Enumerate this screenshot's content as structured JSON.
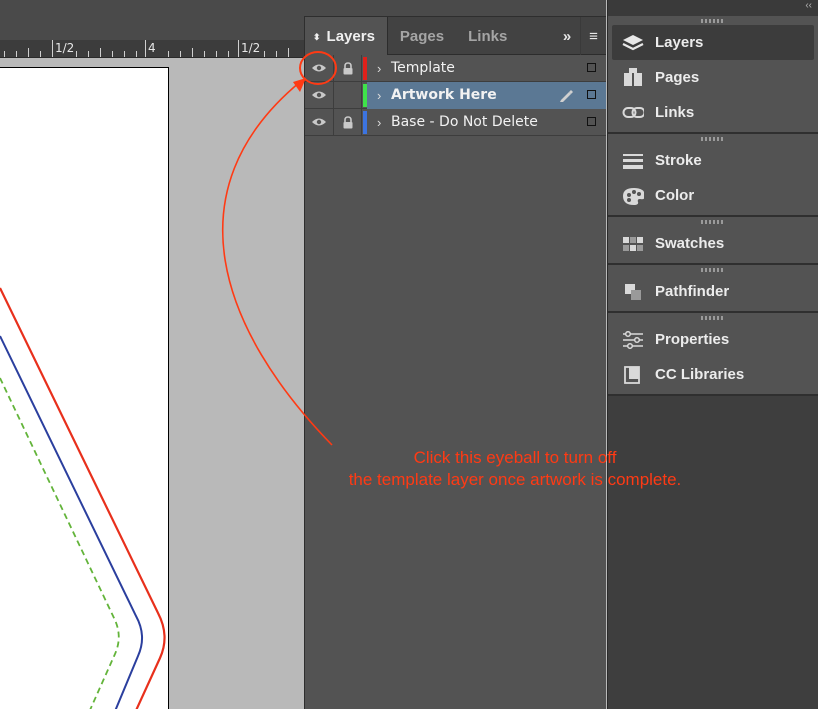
{
  "ruler": {
    "labels": [
      "1/2",
      "4",
      "1/2"
    ]
  },
  "layers_panel": {
    "tabs": [
      {
        "label": "Layers"
      },
      {
        "label": "Pages"
      },
      {
        "label": "Links"
      }
    ],
    "expand_glyph": "»",
    "menu_glyph": "≡",
    "layers": [
      {
        "name": "Template",
        "color": "#e0201a",
        "visible": true,
        "locked": true,
        "selected": false
      },
      {
        "name": "Artwork Here",
        "color": "#3fe24a",
        "visible": true,
        "locked": false,
        "selected": true
      },
      {
        "name": "Base - Do Not Delete",
        "color": "#3c74e0",
        "visible": true,
        "locked": true,
        "selected": false
      }
    ]
  },
  "dock": {
    "collapse_glyph": "‹‹",
    "groups": [
      {
        "items": [
          {
            "label": "Layers",
            "icon": "layers-icon",
            "active": true
          },
          {
            "label": "Pages",
            "icon": "pages-icon",
            "active": false
          },
          {
            "label": "Links",
            "icon": "links-icon",
            "active": false
          }
        ]
      },
      {
        "items": [
          {
            "label": "Stroke",
            "icon": "stroke-icon",
            "active": false
          },
          {
            "label": "Color",
            "icon": "color-palette-icon",
            "active": false
          }
        ]
      },
      {
        "items": [
          {
            "label": "Swatches",
            "icon": "swatches-icon",
            "active": false
          }
        ]
      },
      {
        "items": [
          {
            "label": "Pathfinder",
            "icon": "pathfinder-icon",
            "active": false
          }
        ]
      },
      {
        "items": [
          {
            "label": "Properties",
            "icon": "properties-icon",
            "active": false
          },
          {
            "label": "CC Libraries",
            "icon": "cc-libraries-icon",
            "active": false
          }
        ]
      }
    ]
  },
  "annotation": {
    "line1": "Click this eyeball to turn off",
    "line2": "the template layer once artwork is complete.",
    "color": "#ff3a14"
  },
  "dieline_colors": {
    "cut": "#e8301c",
    "trim": "#2b3f9e",
    "safe": "#63b43a"
  }
}
